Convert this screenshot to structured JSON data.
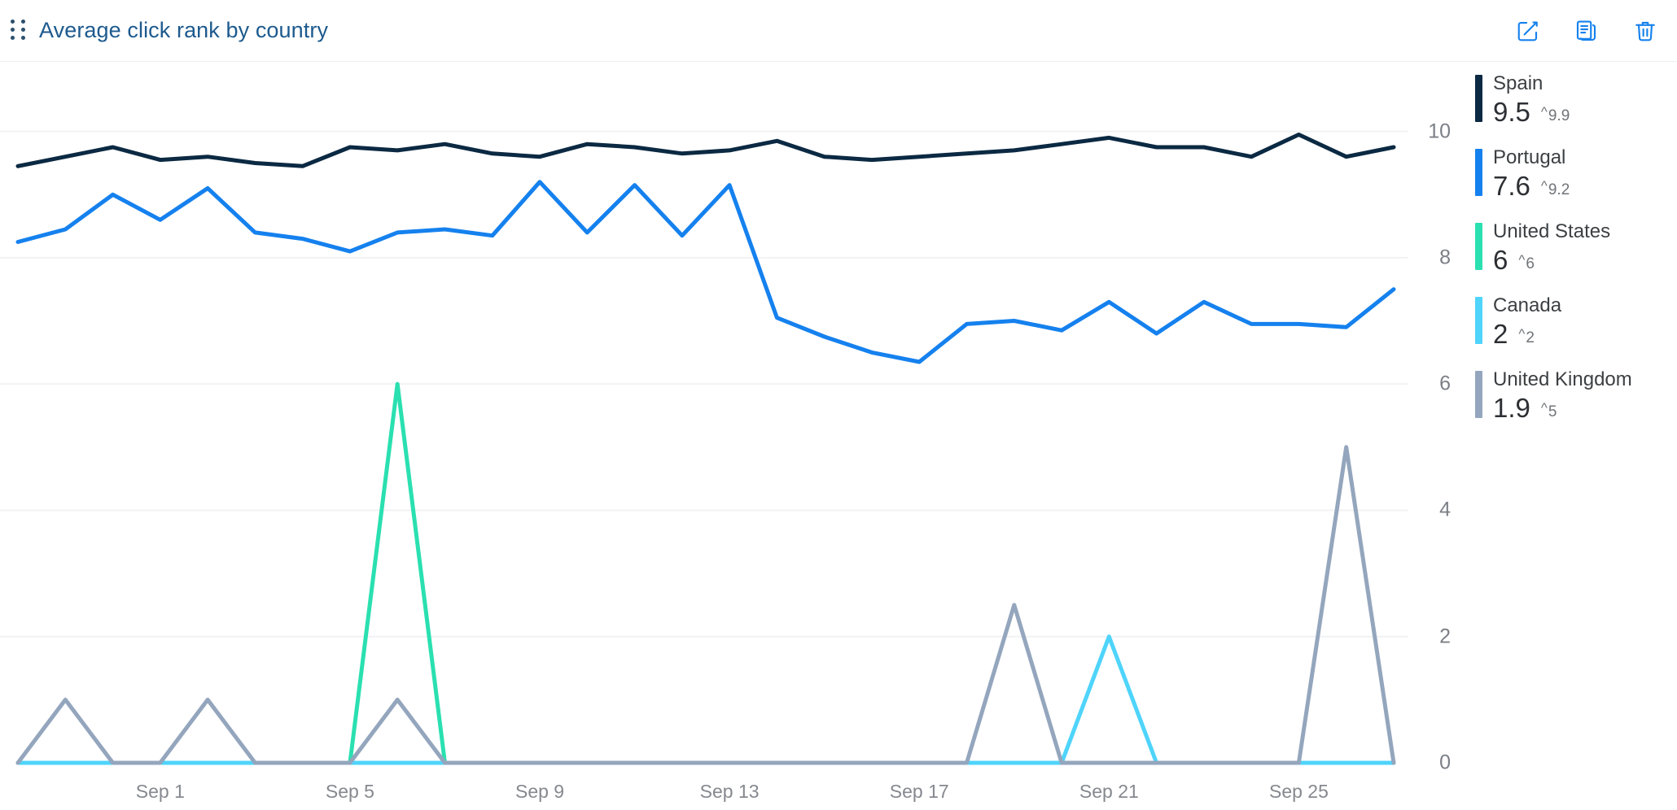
{
  "header": {
    "title": "Average click rank by country",
    "drag_handle_icon": "drag-dots-icon",
    "actions": [
      {
        "name": "edit-button",
        "icon": "edit-pencil-square-icon",
        "label": "Edit"
      },
      {
        "name": "duplicate-button",
        "icon": "duplicate-documents-icon",
        "label": "Duplicate"
      },
      {
        "name": "delete-button",
        "icon": "trash-can-icon",
        "label": "Delete"
      }
    ],
    "accent_color": "#1581ee",
    "title_color": "#1d5a8e"
  },
  "legend": {
    "items": [
      {
        "label": "Spain",
        "value": "9.5",
        "peak": "9.9",
        "caret": "^",
        "color": "#0b2942"
      },
      {
        "label": "Portugal",
        "value": "7.6",
        "peak": "9.2",
        "caret": "^",
        "color": "#1581ee"
      },
      {
        "label": "United States",
        "value": "6",
        "peak": "6",
        "caret": "^",
        "color": "#2ae0b0"
      },
      {
        "label": "Canada",
        "value": "2",
        "peak": "2",
        "caret": "^",
        "color": "#4fd4fb"
      },
      {
        "label": "United Kingdom",
        "value": "1.9",
        "peak": "5",
        "caret": "^",
        "color": "#94a6bd"
      }
    ]
  },
  "chart_data": {
    "type": "line",
    "title": "Average click rank by country",
    "xlabel": "",
    "ylabel": "",
    "ylim": [
      0,
      11
    ],
    "yticks": [
      0,
      2,
      4,
      6,
      8,
      10
    ],
    "ytick_labels": [
      "0",
      "2",
      "4",
      "6",
      "8",
      "10"
    ],
    "grid": true,
    "grid_axis": "y",
    "legend_position": "right",
    "x": [
      "Aug 29",
      "Aug 30",
      "Aug 31",
      "Sep 1",
      "Sep 2",
      "Sep 3",
      "Sep 4",
      "Sep 5",
      "Sep 6",
      "Sep 7",
      "Sep 8",
      "Sep 9",
      "Sep 10",
      "Sep 11",
      "Sep 12",
      "Sep 13",
      "Sep 14",
      "Sep 15",
      "Sep 16",
      "Sep 17",
      "Sep 18",
      "Sep 19",
      "Sep 20",
      "Sep 21",
      "Sep 22",
      "Sep 23",
      "Sep 24",
      "Sep 25",
      "Sep 26",
      "Sep 27"
    ],
    "xtick_labels": [
      "Sep 1",
      "Sep 5",
      "Sep 9",
      "Sep 13",
      "Sep 17",
      "Sep 21",
      "Sep 25"
    ],
    "xtick_indices": [
      3,
      7,
      11,
      15,
      19,
      23,
      27
    ],
    "series": [
      {
        "name": "Spain",
        "color": "#0b2942",
        "values": [
          9.45,
          9.6,
          9.75,
          9.55,
          9.6,
          9.5,
          9.45,
          9.75,
          9.7,
          9.8,
          9.65,
          9.6,
          9.8,
          9.75,
          9.65,
          9.7,
          9.85,
          9.6,
          9.55,
          9.6,
          9.65,
          9.7,
          9.8,
          9.9,
          9.75,
          9.75,
          9.6,
          9.95,
          9.6,
          9.75
        ]
      },
      {
        "name": "Portugal",
        "color": "#1581ee",
        "values": [
          8.25,
          8.45,
          9.0,
          8.6,
          9.1,
          8.4,
          8.3,
          8.1,
          8.4,
          8.45,
          8.35,
          9.2,
          8.4,
          9.15,
          8.35,
          9.15,
          7.05,
          6.75,
          6.5,
          6.35,
          6.95,
          7.0,
          6.85,
          7.3,
          6.8,
          7.3,
          6.95,
          6.95,
          6.9,
          7.5
        ]
      },
      {
        "name": "United States",
        "color": "#2ae0b0",
        "values": [
          0,
          0,
          0,
          0,
          0,
          0,
          0,
          0,
          6,
          0,
          0,
          0,
          0,
          0,
          0,
          0,
          0,
          0,
          0,
          0,
          0,
          0,
          0,
          0,
          0,
          0,
          0,
          0,
          0,
          0
        ]
      },
      {
        "name": "Canada",
        "color": "#4fd4fb",
        "values": [
          0,
          0,
          0,
          0,
          0,
          0,
          0,
          0,
          0,
          0,
          0,
          0,
          0,
          0,
          0,
          0,
          0,
          0,
          0,
          0,
          0,
          0,
          0,
          2,
          0,
          0,
          0,
          0,
          0,
          0
        ]
      },
      {
        "name": "United Kingdom",
        "color": "#94a6bd",
        "values": [
          0,
          1,
          0,
          0,
          1,
          0,
          0,
          0,
          1,
          0,
          0,
          0,
          0,
          0,
          0,
          0,
          0,
          0,
          0,
          0,
          0,
          2.5,
          0,
          0,
          0,
          0,
          0,
          0,
          5,
          0
        ]
      }
    ]
  }
}
